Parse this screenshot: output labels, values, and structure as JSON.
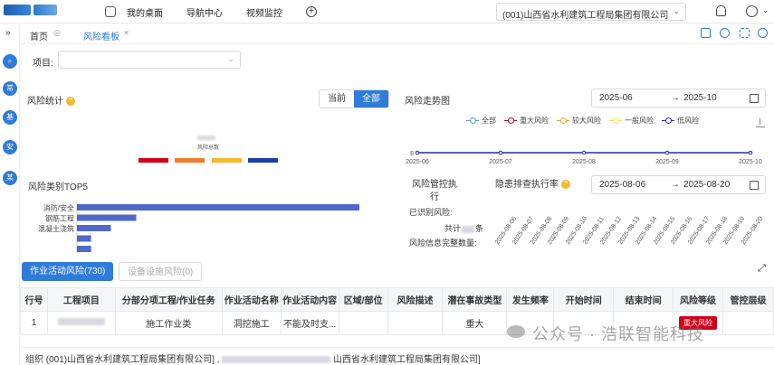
{
  "header": {
    "nav_items": [
      "我的桌面",
      "导航中心",
      "视频监控"
    ],
    "org_select": "(001)山西省水利建筑工程局集团有限公司"
  },
  "sidebar": {
    "collapse_glyph": "»",
    "buttons": [
      "常",
      "基",
      "安",
      "某"
    ]
  },
  "tabs": {
    "home": "首页",
    "active": "风险看板",
    "close_glyph": "×"
  },
  "filter": {
    "label": "项目:",
    "value": ""
  },
  "risk_stats": {
    "title": "风险统计",
    "toggle": [
      "当前",
      "全部"
    ],
    "total_caption": "风险总数",
    "bar_colors": [
      "#d0021b",
      "#f07c2b",
      "#f5b82e",
      "#1c3fa8"
    ]
  },
  "risk_trend": {
    "title": "风险走势图",
    "date_start": "2025-06",
    "date_end": "2025-10",
    "arrow": "→",
    "legend": [
      {
        "label": "全部",
        "color": "#5b9bd5"
      },
      {
        "label": "重大风险",
        "color": "#d0021b"
      },
      {
        "label": "较大风险",
        "color": "#f0a030"
      },
      {
        "label": "一般风险",
        "color": "#f7e04b"
      },
      {
        "label": "低风险",
        "color": "#2828b0"
      }
    ]
  },
  "top5": {
    "title": "风险类别TOP5"
  },
  "control": {
    "title_line1": "风险管控执",
    "title_line2": "行",
    "identified": "已识别风险:",
    "total_prefix": "共计",
    "total_suffix": "条",
    "info_complete": "风险信息完整数量:"
  },
  "inspection": {
    "title": "隐患排查执行率",
    "date_start": "2025-08-06",
    "date_end": "2025-08-20",
    "arrow": "→"
  },
  "bottom_tabs": {
    "active": "作业活动风险(730)",
    "inactive": "设备设施风险(0)"
  },
  "table": {
    "headers": [
      "行号",
      "工程项目",
      "分部分项工程/作业任务",
      "作业活动名称",
      "作业活动内容",
      "区域/部位",
      "风险描述",
      "潜在事故类型",
      "发生频率",
      "开始时间",
      "结束时间",
      "风险等级",
      "管控层级"
    ],
    "rows": [
      {
        "no": "1",
        "project": "",
        "task": "施工作业类",
        "activity": "洞挖施工",
        "content": "不能及时支...",
        "area": "",
        "desc": "",
        "accident": "重大",
        "freq": "",
        "start": "",
        "end": "",
        "level": "重大风险",
        "control": ""
      }
    ]
  },
  "footer": {
    "org_text": "组织 (001)山西省水利建筑工程局集团有限公司] ,",
    "org_text2": "山西省水利建筑工程局集团有限公司]"
  },
  "watermark": "公众号 · 浩联智能科技",
  "chart_data": [
    {
      "type": "line",
      "title": "风险走势图",
      "x": [
        "2025-06",
        "2025-07",
        "2025-08",
        "2025-09",
        "2025-10"
      ],
      "y_tick_label": "8",
      "series": [
        {
          "name": "低风险",
          "values": [
            8,
            8,
            8,
            8,
            8
          ]
        }
      ]
    },
    {
      "type": "bar",
      "title": "风险类别TOP5",
      "orientation": "horizontal",
      "categories": [
        "消防/安全",
        "钢筋工程",
        "混凝土浇筑",
        "",
        ""
      ],
      "values": [
        100,
        21,
        12,
        5,
        5
      ]
    },
    {
      "type": "line",
      "title": "隐患排查执行率",
      "x": [
        "2025-08-06",
        "2025-08-07",
        "2025-08-08",
        "2025-08-09",
        "2025-08-10",
        "2025-08-11",
        "2025-08-12",
        "2025-08-13",
        "2025-08-14",
        "2025-08-15",
        "2025-08-16",
        "2025-08-17",
        "2025-08-18",
        "2025-08-19",
        "2025-08-20"
      ]
    }
  ]
}
